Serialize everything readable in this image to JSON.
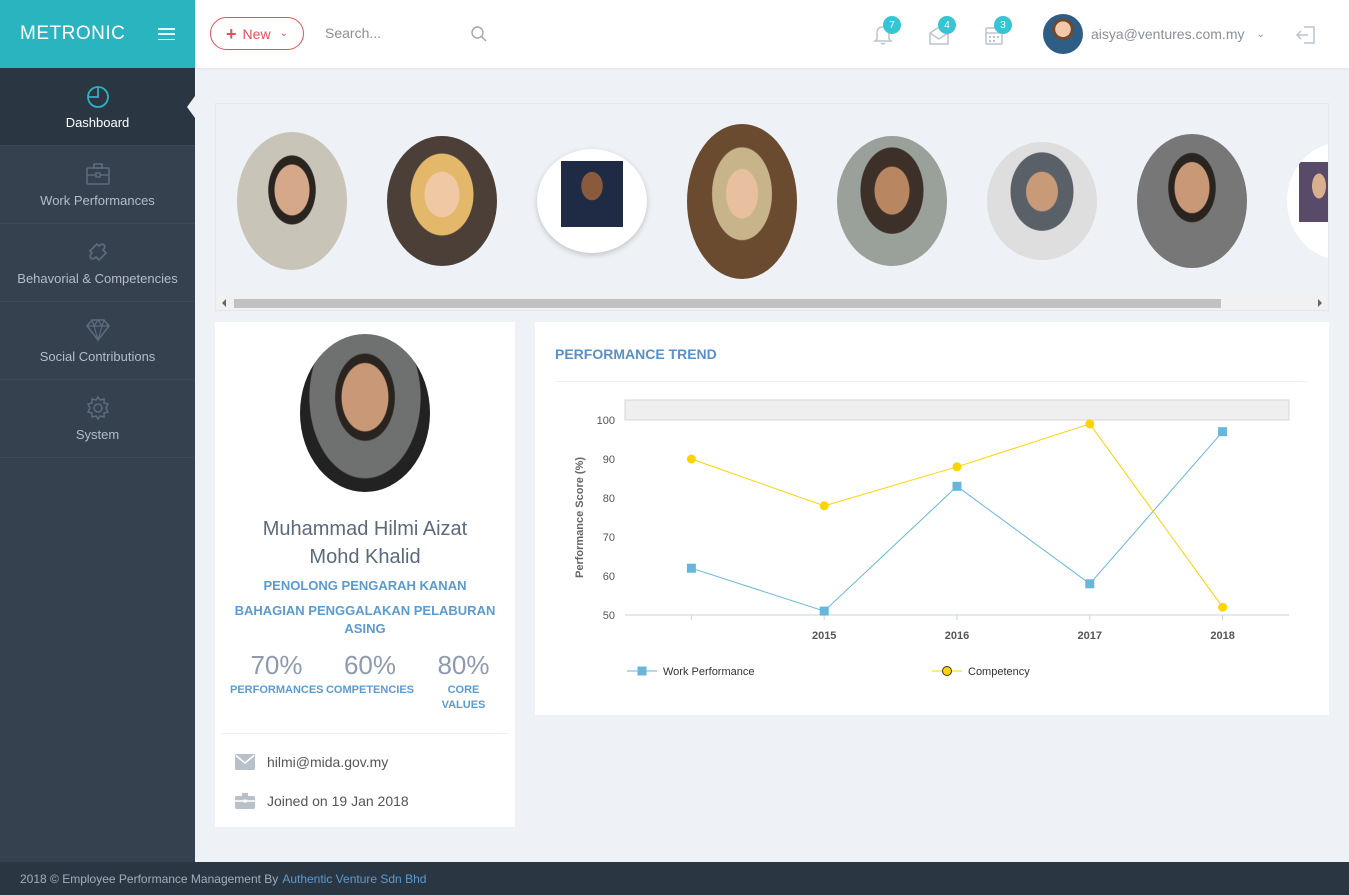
{
  "brand": {
    "name": "METRONIC"
  },
  "sidebar": {
    "items": [
      {
        "label": "Dashboard",
        "icon": "pie-chart-icon"
      },
      {
        "label": "Work Performances",
        "icon": "briefcase-icon"
      },
      {
        "label": "Behavorial & Competencies",
        "icon": "puzzle-icon"
      },
      {
        "label": "Social Contributions",
        "icon": "diamond-icon"
      },
      {
        "label": "System",
        "icon": "gear-icon"
      }
    ]
  },
  "header": {
    "new_label": "New",
    "search_placeholder": "Search...",
    "notifications_count": "7",
    "inbox_count": "4",
    "tasks_count": "3",
    "user_email": "aisya@ventures.com.my"
  },
  "profile": {
    "name_line1": "Muhammad Hilmi Aizat",
    "name_line2": "Mohd Khalid",
    "title": "PENOLONG PENGARAH KANAN",
    "department": "BAHAGIAN PENGGALAKAN PELABURAN ASING",
    "stats": [
      {
        "value": "70%",
        "label": "PERFORMANCES"
      },
      {
        "value": "60%",
        "label": "COMPETENCIES"
      },
      {
        "value": "80%",
        "label": "CORE VALUES"
      }
    ],
    "email": "hilmi@mida.gov.my",
    "joined": "Joined on 19 Jan 2018"
  },
  "chart_title": "PERFORMANCE TREND",
  "chart_data": {
    "type": "line",
    "ylabel": "Performance Score (%)",
    "xlabel": "",
    "ylim": [
      50,
      100
    ],
    "yticks": [
      50,
      60,
      70,
      80,
      90,
      100
    ],
    "x": [
      "",
      "2015",
      "2016",
      "2017",
      "2018"
    ],
    "series": [
      {
        "name": "Work Performance",
        "color": "#67b7dc",
        "marker": "square",
        "values": [
          62,
          51,
          83,
          58,
          97
        ]
      },
      {
        "name": "Competency",
        "color": "#fdd400",
        "marker": "circle",
        "values": [
          90,
          78,
          88,
          99,
          52
        ]
      }
    ],
    "legend": "bottom",
    "grid": false
  },
  "footer": {
    "text": "2018 © Employee Performance Management By",
    "link": "Authentic Venture Sdn Bhd"
  }
}
